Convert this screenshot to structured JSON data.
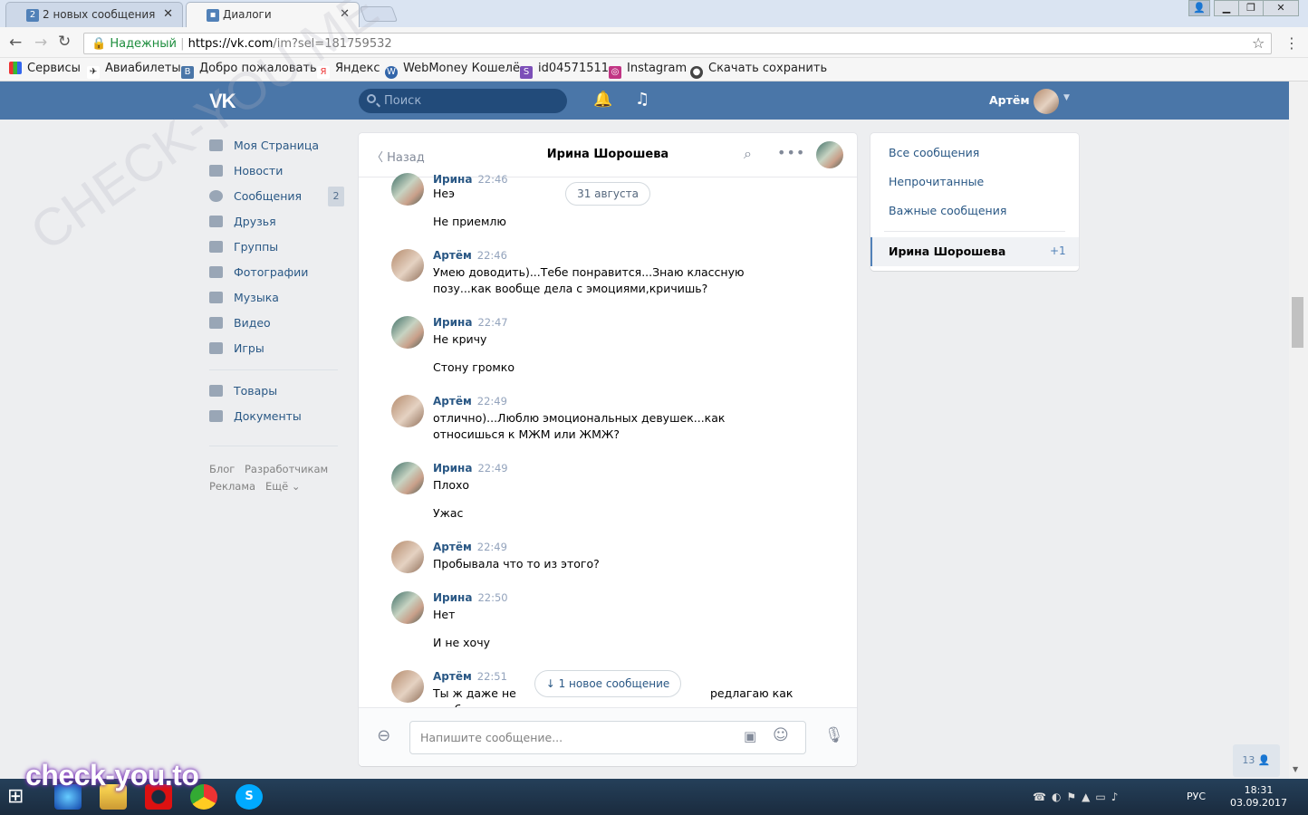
{
  "browser": {
    "tabs": [
      {
        "title": "2 новых сообщения",
        "favicon_text": "2"
      },
      {
        "title": "Диалоги"
      }
    ],
    "secure_label": "Надежный",
    "url_host": "https://vk.com",
    "url_rest": "/im?sel=181759532",
    "bookmarks": [
      "Сервисы",
      "Авиабилеты",
      "Добро пожаловать",
      "Яндекс",
      "WebMoney Кошелё",
      "id04571511",
      "Instagram",
      "Скачать сохранить"
    ]
  },
  "vk": {
    "logo": "VK",
    "search_placeholder": "Поиск",
    "user_name": "Артём",
    "menu": [
      {
        "label": "Моя Страница"
      },
      {
        "label": "Новости"
      },
      {
        "label": "Сообщения",
        "badge": "2"
      },
      {
        "label": "Друзья"
      },
      {
        "label": "Группы"
      },
      {
        "label": "Фотографии"
      },
      {
        "label": "Музыка"
      },
      {
        "label": "Видео"
      },
      {
        "label": "Игры"
      },
      {
        "label": "Товары"
      },
      {
        "label": "Документы"
      }
    ],
    "footer_links": [
      "Блог",
      "Разработчикам",
      "Реклама",
      "Ещё"
    ]
  },
  "chat": {
    "back_label": "Назад",
    "title": "Ирина Шорошева",
    "date_divider": "31 августа",
    "messages": [
      {
        "author": "Ирина",
        "time": "22:46",
        "lines": [
          "Неэ",
          "Не приемлю"
        ]
      },
      {
        "author": "Артём",
        "time": "22:46",
        "lines": [
          "Умею доводить)...Тебе понравится...Знаю классную позу...как вообще дела с эмоциями,кричишь?"
        ]
      },
      {
        "author": "Ирина",
        "time": "22:47",
        "lines": [
          "Не кричу",
          "Стону громко"
        ]
      },
      {
        "author": "Артём",
        "time": "22:49",
        "lines": [
          "отлично)...Люблю эмоциональных девушек...как относишься к МЖМ или ЖМЖ?"
        ]
      },
      {
        "author": "Ирина",
        "time": "22:49",
        "lines": [
          "Плохо",
          "Ужас"
        ]
      },
      {
        "author": "Артём",
        "time": "22:49",
        "lines": [
          "Пробывала что то из этого?"
        ]
      },
      {
        "author": "Ирина",
        "time": "22:50",
        "lines": [
          "Нет",
          "И не хочу"
        ]
      },
      {
        "author": "Артём",
        "time": "22:51",
        "lines": [
          "Ты ж даже не проб",
          "редлагаю как"
        ]
      }
    ],
    "new_message_pill": "1 новое сообщение",
    "composer_placeholder": "Напишите сообщение..."
  },
  "right_panel": {
    "links": [
      "Все сообщения",
      "Непрочитанные",
      "Важные сообщения"
    ],
    "conversation": {
      "name": "Ирина Шорошева",
      "unread": "+1"
    }
  },
  "online_counter": "13",
  "taskbar": {
    "language": "РУС",
    "time": "18:31",
    "date": "03.09.2017"
  },
  "watermark": "check-you.to",
  "diagonal_watermark": "CHECK-YOU.ME"
}
